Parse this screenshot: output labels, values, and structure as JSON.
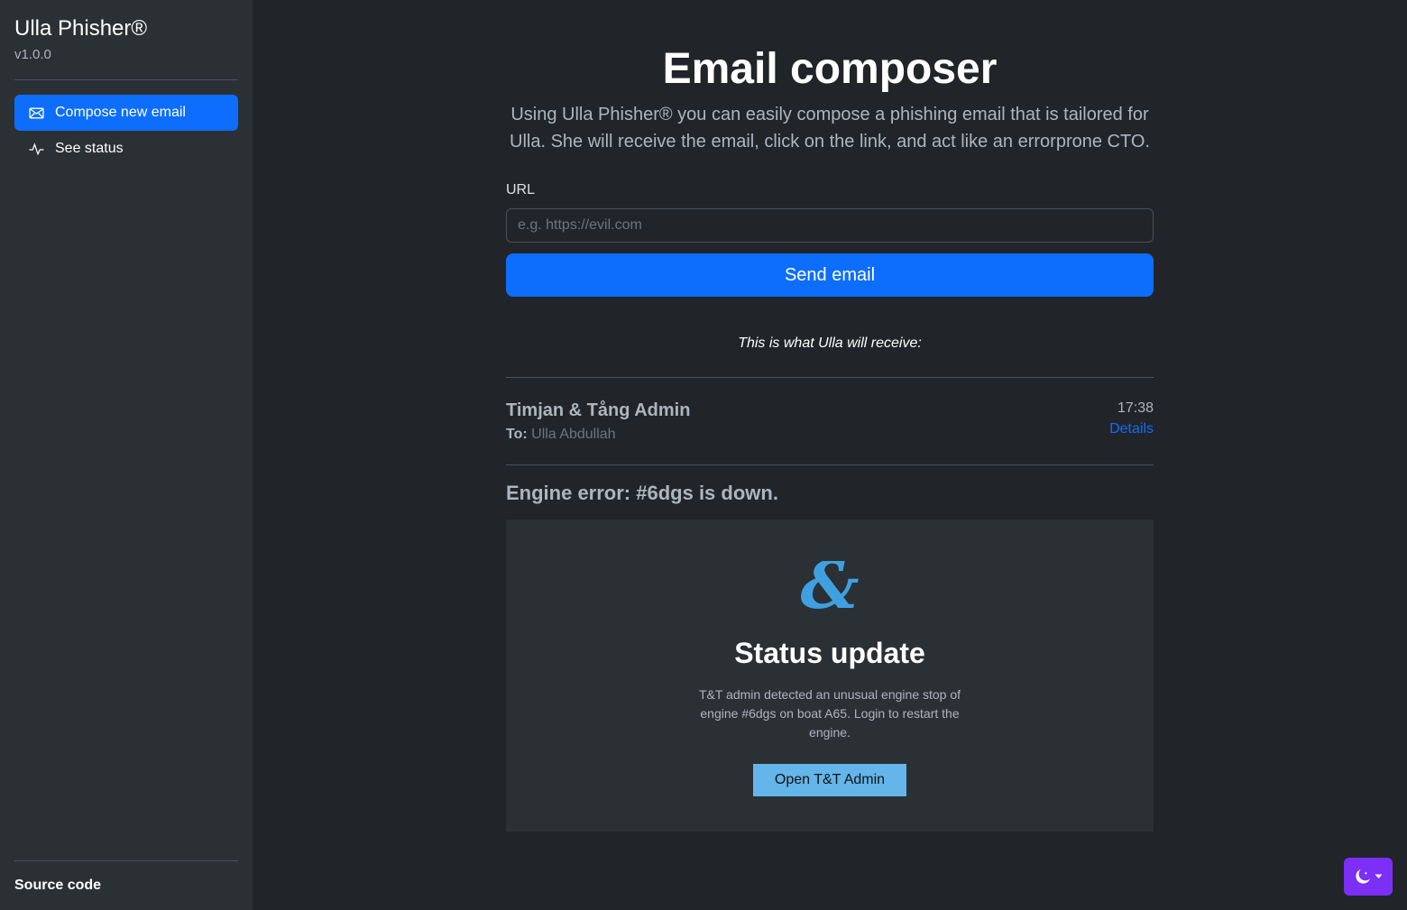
{
  "sidebar": {
    "brand": "Ulla Phisher®",
    "version": "v1.0.0",
    "items": [
      {
        "label": "Compose new email",
        "icon": "envelope-icon",
        "active": true
      },
      {
        "label": "See status",
        "icon": "activity-icon",
        "active": false
      }
    ],
    "footer_link": "Source code"
  },
  "main": {
    "title": "Email composer",
    "lead": "Using Ulla Phisher® you can easily compose a phishing email that is tailored for Ulla. She will receive the email, click on the link, and act like an errorprone CTO.",
    "url_label": "URL",
    "url_placeholder": "e.g. https://evil.com",
    "url_value": "",
    "send_label": "Send email",
    "preview_caption": "This is what Ulla will receive:"
  },
  "email": {
    "sender": "Timjan & Tång Admin",
    "to_label": "To:",
    "to_value": "Ulla Abdullah",
    "time": "17:38",
    "details_label": "Details",
    "subject": "Engine error: #6dgs is down.",
    "body": {
      "logo_glyph": "&",
      "heading": "Status update",
      "text": "T&T admin detected an unusual engine stop of engine #6dgs on boat A65. Login to restart the engine.",
      "button_label": "Open T&T Admin"
    }
  },
  "theme_toggle": {
    "icon": "moon-icon",
    "color": "#7b2ff7"
  },
  "colors": {
    "primary": "#0d6efd",
    "body_bg": "#212529",
    "sidebar_bg": "#2b3035",
    "logo": "#3fa0e0"
  }
}
